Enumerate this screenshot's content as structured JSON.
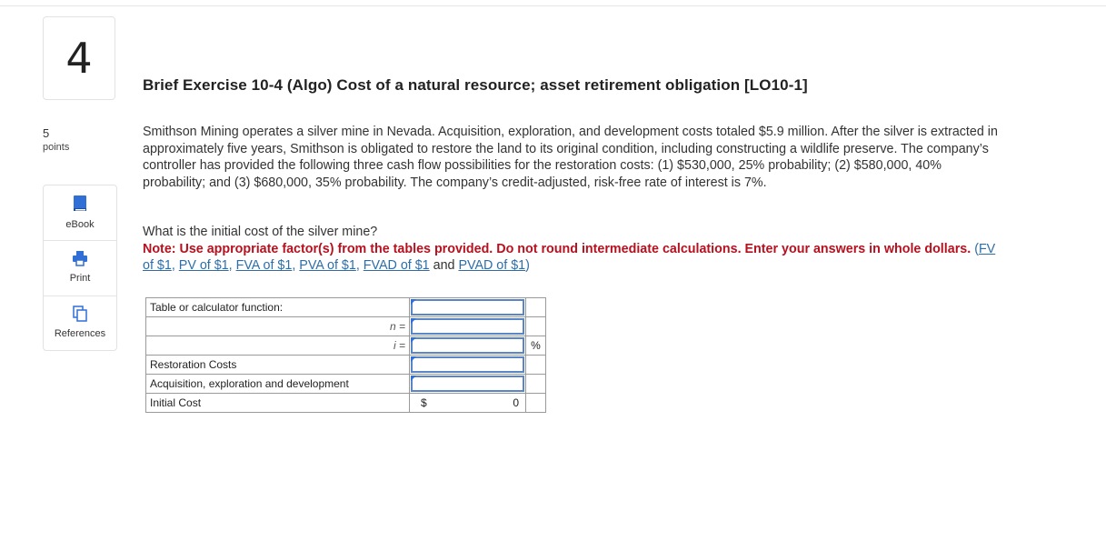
{
  "question": {
    "number": "4",
    "points_value": "5",
    "points_label": "points",
    "title": "Brief Exercise 10-4 (Algo) Cost of a natural resource; asset retirement obligation [LO10-1]",
    "description": "Smithson Mining operates a silver mine in Nevada. Acquisition, exploration, and development costs totaled $5.9 million. After the silver is extracted in approximately five years, Smithson is obligated to restore the land to its original condition, including constructing a wildlife preserve. The company’s controller has provided the following three cash flow possibilities for the restoration costs: (1) $530,000, 25% probability; (2) $580,000, 40% probability; and (3) $680,000, 35% probability. The company’s credit-adjusted, risk-free rate of interest is 7%.",
    "prompt": "What is the initial cost of the silver mine?",
    "note_text": "Note: Use appropriate factor(s) from the tables provided. Do not round intermediate calculations. Enter your answers in whole dollars.",
    "links": {
      "open_paren": "(",
      "fv": "FV of $1",
      "pv": "PV of $1",
      "fva": "FVA of $1",
      "pva": "PVA of $1",
      "fvad": "FVAD of $1",
      "and": "and",
      "pvad": "PVAD of $1",
      "close_paren": ")",
      "sep": ","
    }
  },
  "tools": {
    "ebook": "eBook",
    "print": "Print",
    "references": "References"
  },
  "icons": {
    "ebook": "book-icon",
    "print": "printer-icon",
    "references": "copy-pages-icon"
  },
  "calc_table": {
    "table_label": "Table or calculator function:",
    "n_label": "n =",
    "i_label": "i =",
    "percent": "%",
    "restoration": "Restoration Costs",
    "acquisition": "Acquisition, exploration and development",
    "initial": "Initial Cost",
    "currency": "$",
    "initial_value": "0"
  },
  "colors": {
    "note_red": "#b5111f",
    "link_blue": "#2e6ea8",
    "input_border": "#5b86c5"
  }
}
